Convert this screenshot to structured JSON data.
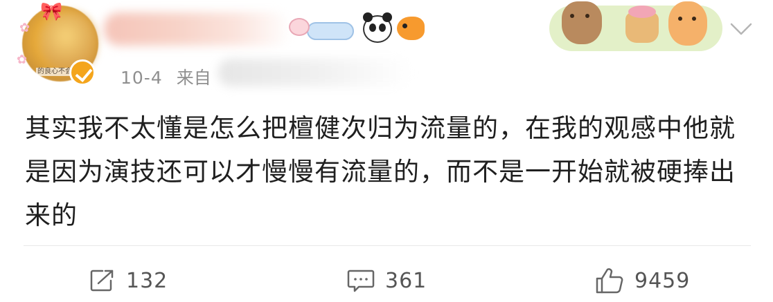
{
  "post": {
    "avatar_caption": "的良心不会",
    "date": "10-4",
    "source_prefix": "来自",
    "body": "其实我不太懂是怎么把檀健次归为流量的，在我的观感中他就是因为演技还可以才慢慢有流量的，而不是一开始就被硬捧出来的"
  },
  "actions": {
    "repost_count": "132",
    "comment_count": "361",
    "like_count": "9459"
  },
  "colors": {
    "text": "#1f1f1f",
    "meta": "#8f8f8f",
    "verified_badge": "#f4a51c",
    "divider": "#e8e8e8"
  }
}
